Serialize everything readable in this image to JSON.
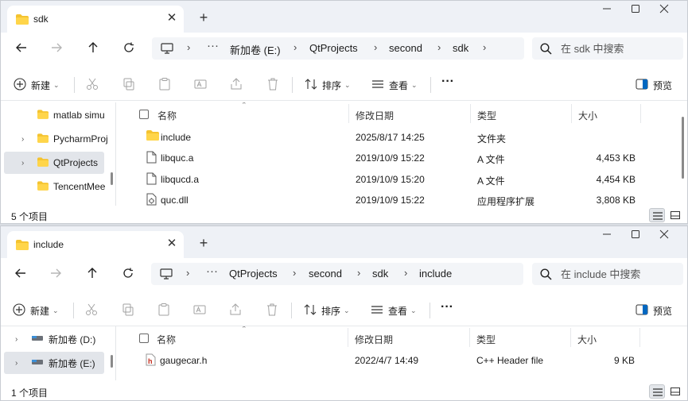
{
  "windows": [
    {
      "tab_title": "sdk",
      "breadcrumbs": [
        "新加卷 (E:)",
        "QtProjects",
        "second",
        "sdk"
      ],
      "search_placeholder": "在 sdk 中搜索",
      "toolbar": {
        "new_label": "新建",
        "sort_label": "排序",
        "view_label": "查看",
        "preview_label": "预览"
      },
      "nav_items": [
        {
          "label": "matlab simu",
          "expandable": false,
          "selected": false,
          "icon": "folder-icon"
        },
        {
          "label": "PycharmProj",
          "expandable": true,
          "selected": false,
          "icon": "folder-icon"
        },
        {
          "label": "QtProjects",
          "expandable": true,
          "selected": true,
          "icon": "folder-icon"
        },
        {
          "label": "TencentMee",
          "expandable": false,
          "selected": false,
          "icon": "folder-icon"
        }
      ],
      "columns": {
        "name": "名称",
        "date": "修改日期",
        "type": "类型",
        "size": "大小"
      },
      "files": [
        {
          "name": "include",
          "date": "2025/8/17 14:25",
          "type": "文件夹",
          "size": "",
          "icon": "folder-icon"
        },
        {
          "name": "libquc.a",
          "date": "2019/10/9 15:22",
          "type": "A 文件",
          "size": "4,453 KB",
          "icon": "file-icon"
        },
        {
          "name": "libqucd.a",
          "date": "2019/10/9 15:20",
          "type": "A 文件",
          "size": "4,454 KB",
          "icon": "file-icon"
        },
        {
          "name": "quc.dll",
          "date": "2019/10/9 15:22",
          "type": "应用程序扩展",
          "size": "3,808 KB",
          "icon": "dll-icon"
        }
      ],
      "status_count": "5 个项目"
    },
    {
      "tab_title": "include",
      "breadcrumbs": [
        "QtProjects",
        "second",
        "sdk",
        "include"
      ],
      "search_placeholder": "在 include 中搜索",
      "toolbar": {
        "new_label": "新建",
        "sort_label": "排序",
        "view_label": "查看",
        "preview_label": "预览"
      },
      "nav_items": [
        {
          "label": "新加卷 (D:)",
          "expandable": true,
          "selected": false,
          "icon": "drive-icon"
        },
        {
          "label": "新加卷 (E:)",
          "expandable": true,
          "selected": true,
          "icon": "drive-icon"
        }
      ],
      "columns": {
        "name": "名称",
        "date": "修改日期",
        "type": "类型",
        "size": "大小"
      },
      "files": [
        {
          "name": "gaugecar.h",
          "date": "2022/4/7 14:49",
          "type": "C++ Header file",
          "size": "9 KB",
          "icon": "header-file-icon"
        }
      ],
      "status_count": "1 个项目"
    }
  ],
  "colors": {
    "folder": "#f4c330",
    "accent": "#0067c0",
    "selected_bg": "#e2e5ea",
    "header_icon_red": "#c42b1c"
  }
}
